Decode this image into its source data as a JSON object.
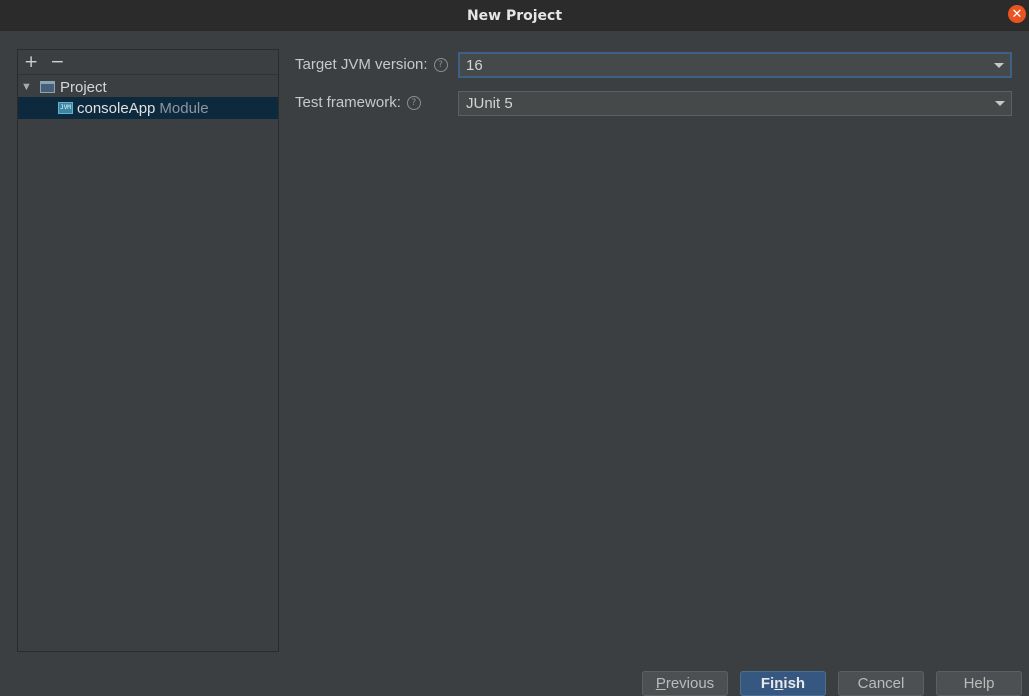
{
  "window": {
    "title": "New Project",
    "close_icon": "close-icon"
  },
  "tree": {
    "toolbar": {
      "add_label": "+",
      "remove_label": "−"
    },
    "project_label": "Project",
    "module": {
      "name": "consoleApp",
      "type": "Module",
      "icon_text": "JVM"
    }
  },
  "form": {
    "jvm_label": "Target JVM version:",
    "jvm_value": "16",
    "test_label": "Test framework:",
    "test_value": "JUnit 5",
    "help_glyph": "?"
  },
  "buttons": {
    "previous": {
      "pre": "",
      "mnemonic": "P",
      "post": "revious"
    },
    "finish": {
      "pre": "Fi",
      "mnemonic": "n",
      "post": "ish"
    },
    "cancel": "Cancel",
    "help": "Help"
  },
  "colors": {
    "background": "#3c3f41",
    "titlebar": "#2b2b2b",
    "selection": "#0d293e",
    "primary_button": "#365880",
    "close_button": "#e95420"
  }
}
